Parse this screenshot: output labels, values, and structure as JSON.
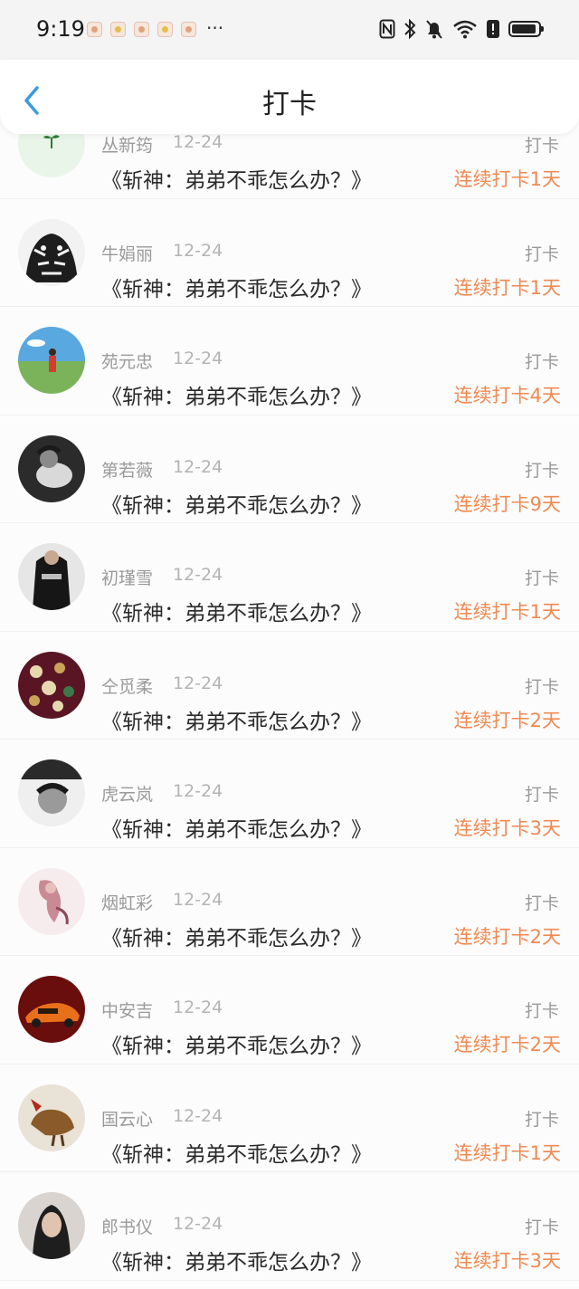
{
  "status_bar": {
    "time": "9:19",
    "more": "···",
    "notification_icons": [
      "app-notification-icon",
      "app-notification-icon",
      "app-notification-icon",
      "app-notification-icon",
      "app-notification-icon"
    ],
    "system_icons": [
      "nfc-icon",
      "bluetooth-icon",
      "mute-icon",
      "wifi-icon",
      "alert-icon",
      "battery-icon"
    ]
  },
  "header": {
    "title": "打卡",
    "back_icon": "chevron-left-icon",
    "accent": "#3a9be0"
  },
  "colors": {
    "streak": "#ef8a52",
    "meta": "#9a9a9a"
  },
  "rows": [
    {
      "name": "丛新筠",
      "date": "12-24",
      "book": "《斩神：弟弟不乖怎么办？》",
      "action": "打卡",
      "streak": "连续打卡1天"
    },
    {
      "name": "牛娟丽",
      "date": "12-24",
      "book": "《斩神：弟弟不乖怎么办？》",
      "action": "打卡",
      "streak": "连续打卡1天"
    },
    {
      "name": "苑元忠",
      "date": "12-24",
      "book": "《斩神：弟弟不乖怎么办？》",
      "action": "打卡",
      "streak": "连续打卡4天"
    },
    {
      "name": "第若薇",
      "date": "12-24",
      "book": "《斩神：弟弟不乖怎么办？》",
      "action": "打卡",
      "streak": "连续打卡9天"
    },
    {
      "name": "初瑾雪",
      "date": "12-24",
      "book": "《斩神：弟弟不乖怎么办？》",
      "action": "打卡",
      "streak": "连续打卡1天"
    },
    {
      "name": "仝觅柔",
      "date": "12-24",
      "book": "《斩神：弟弟不乖怎么办？》",
      "action": "打卡",
      "streak": "连续打卡2天"
    },
    {
      "name": "虎云岚",
      "date": "12-24",
      "book": "《斩神：弟弟不乖怎么办？》",
      "action": "打卡",
      "streak": "连续打卡3天"
    },
    {
      "name": "烟虹彩",
      "date": "12-24",
      "book": "《斩神：弟弟不乖怎么办？》",
      "action": "打卡",
      "streak": "连续打卡2天"
    },
    {
      "name": "中安吉",
      "date": "12-24",
      "book": "《斩神：弟弟不乖怎么办？》",
      "action": "打卡",
      "streak": "连续打卡2天"
    },
    {
      "name": "国云心",
      "date": "12-24",
      "book": "《斩神：弟弟不乖怎么办？》",
      "action": "打卡",
      "streak": "连续打卡1天"
    },
    {
      "name": "郎书仪",
      "date": "12-24",
      "book": "《斩神：弟弟不乖怎么办？》",
      "action": "打卡",
      "streak": "连续打卡3天"
    }
  ]
}
